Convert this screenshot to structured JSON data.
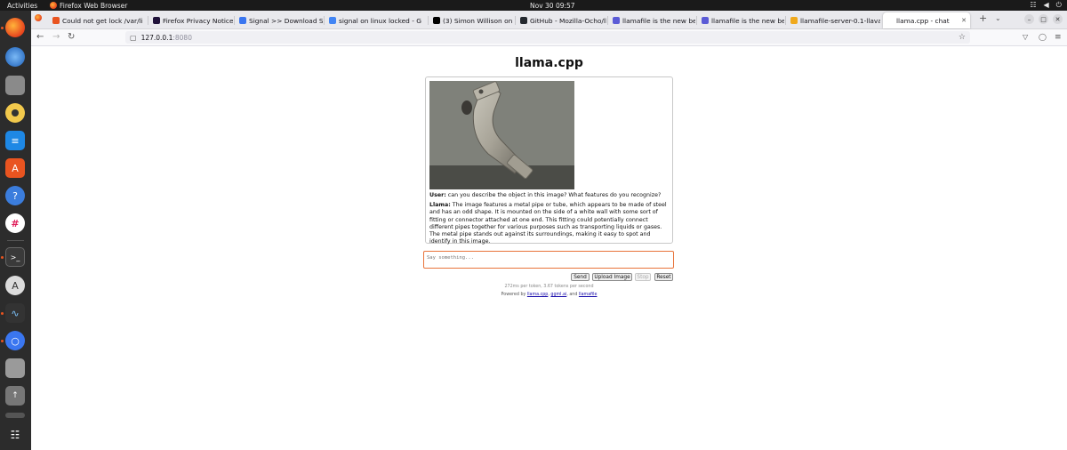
{
  "system": {
    "activities": "Activities",
    "app_name": "Firefox Web Browser",
    "clock": "Nov 30  09:57"
  },
  "dock": {
    "items": [
      "firefox-icon",
      "thunderbird-icon",
      "files-icon",
      "rhythmbox-icon",
      "writer-icon",
      "app-center-icon",
      "help-icon",
      "slack-icon",
      "terminal-icon",
      "updater-icon",
      "system-monitor-icon",
      "signal-icon",
      "disk-icon",
      "usb-icon",
      "trash-icon",
      "show-apps-icon"
    ]
  },
  "browser": {
    "tabs": [
      {
        "label": "Could not get lock /var/li",
        "favicon_color": "#e95420"
      },
      {
        "label": "Firefox Privacy Notice —",
        "favicon_color": "#20123a"
      },
      {
        "label": "Signal >> Download Sig",
        "favicon_color": "#3a76f0"
      },
      {
        "label": "signal on linux locked - G",
        "favicon_color": "#4285f4"
      },
      {
        "label": "(3) Simon Willison on X:",
        "favicon_color": "#000000"
      },
      {
        "label": "GitHub - Mozilla-Ocho/ll",
        "favicon_color": "#24292f"
      },
      {
        "label": "llamafile is the new best",
        "favicon_color": "#5b5bd6"
      },
      {
        "label": "llamafile is the new best",
        "favicon_color": "#5b5bd6"
      },
      {
        "label": "llamafile-server-0.1-llava",
        "favicon_color": "#f0a91c"
      },
      {
        "label": "llama.cpp - chat",
        "favicon_color": "#ffffff"
      }
    ],
    "url_host": "127.0.0.1",
    "url_port": ":8080"
  },
  "page": {
    "title": "llama.cpp",
    "user_speaker": "User:",
    "user_message": " can you describe the object in this image? What features do you recognize?",
    "llama_speaker": "Llama:",
    "llama_message": " The image features a metal pipe or tube, which appears to be made of steel and has an odd shape. It is mounted on the side of a white wall with some sort of fitting or connector attached at one end. This fitting could potentially connect different pipes together for various purposes such as transporting liquids or gases. The metal pipe stands out against its surroundings, making it easy to spot and identify in this image.",
    "input_placeholder": "Say something...",
    "send_label": "Send",
    "upload_label": "Upload Image",
    "stop_label": "Stop",
    "reset_label": "Reset",
    "stats": "272ms per token, 3.67 tokens per second",
    "powered_prefix": "Powered by ",
    "powered_link1": "llama.cpp",
    "powered_sep": ", ",
    "powered_link2": "ggml.ai",
    "powered_and": ", and ",
    "powered_link3": "llamafile"
  }
}
